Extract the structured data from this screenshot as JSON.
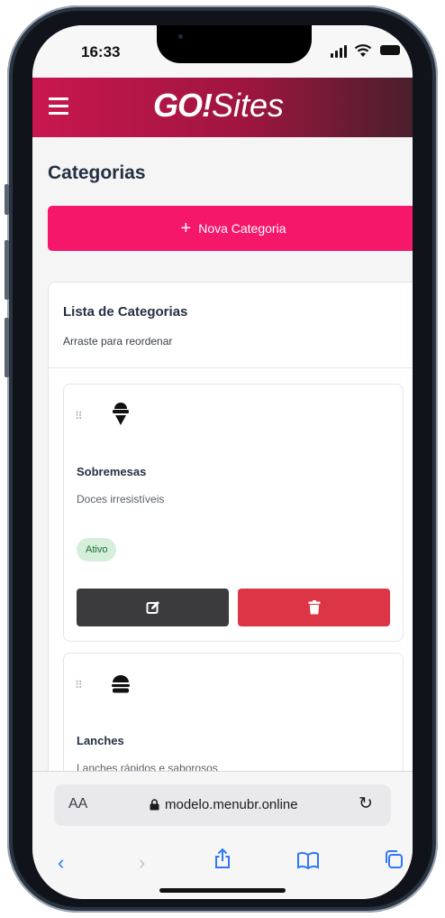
{
  "status_bar": {
    "time": "16:33"
  },
  "header": {
    "logo_go": "GO!",
    "logo_sites": "Sites",
    "menu_icon": "hamburger-menu-icon"
  },
  "page": {
    "title": "Categorias",
    "new_button_label": "Nova Categoria",
    "new_button_icon": "plus-icon"
  },
  "list": {
    "title": "Lista de Categorias",
    "subtitle": "Arraste para reordenar",
    "items": [
      {
        "name": "Sobremesas",
        "description": "Doces irresistíveis",
        "status": "Ativo",
        "icon": "ice-cream-icon"
      },
      {
        "name": "Lanches",
        "description": "Lanches rápidos e saborosos",
        "icon": "hamburger-icon"
      }
    ]
  },
  "browser": {
    "text_size_label": "AA",
    "url": "modelo.menubr.online"
  },
  "colors": {
    "header_start": "#c8174f",
    "header_end": "#4a1f2c",
    "primary": "#f5176a",
    "edit": "#3b3a3d",
    "delete": "#dc3545",
    "badge_bg": "#d5efdb",
    "badge_text": "#1e6b35",
    "safari_blue": "#2f78f6"
  }
}
